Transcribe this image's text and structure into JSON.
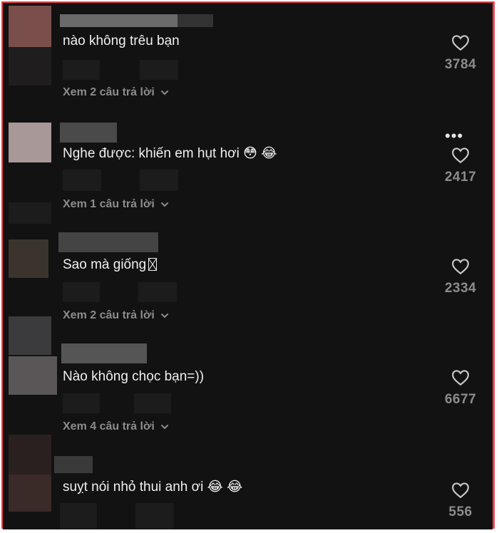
{
  "comments": [
    {
      "text": "nào không trêu bạn",
      "likes": "3784",
      "replies_label": "Xem 2 câu trả lời",
      "avatar_colors": [
        "#7a4f4b",
        "#2a2727",
        "#1b1d20"
      ]
    },
    {
      "text": "Nghe được: khiến em hụt hơi",
      "emojis": [
        "😳",
        "😂"
      ],
      "likes": "2417",
      "replies_label": "Xem 1 câu trả lời",
      "more_label": "•••",
      "avatar_colors": [
        "#a89898",
        "#1f1f1f"
      ]
    },
    {
      "text": "Sao mà giống",
      "likes": "2334",
      "replies_label": "Xem 2 câu trả lời",
      "avatar_colors": [
        "#3a342c",
        "#1a1a1a"
      ]
    },
    {
      "text": "Nào không chọc bạn=))",
      "likes": "6677",
      "replies_label": "Xem 4 câu trả lời",
      "avatar_colors": [
        "#3b3b3e",
        "#5a5658"
      ]
    },
    {
      "text": "suỵt nói nhỏ thui anh ơi",
      "emojis": [
        "😂",
        "😂"
      ],
      "likes": "556",
      "avatar_colors": [
        "#2a201f",
        "#3a2a28"
      ]
    }
  ],
  "colors": {
    "background": "#121212",
    "text": "#f0f0f0",
    "muted": "#8c8c8c",
    "frame": "#e8424d"
  },
  "icons": {
    "like": "heart-outline-icon",
    "replies": "chevron-down-icon",
    "more": "more-options-icon"
  }
}
